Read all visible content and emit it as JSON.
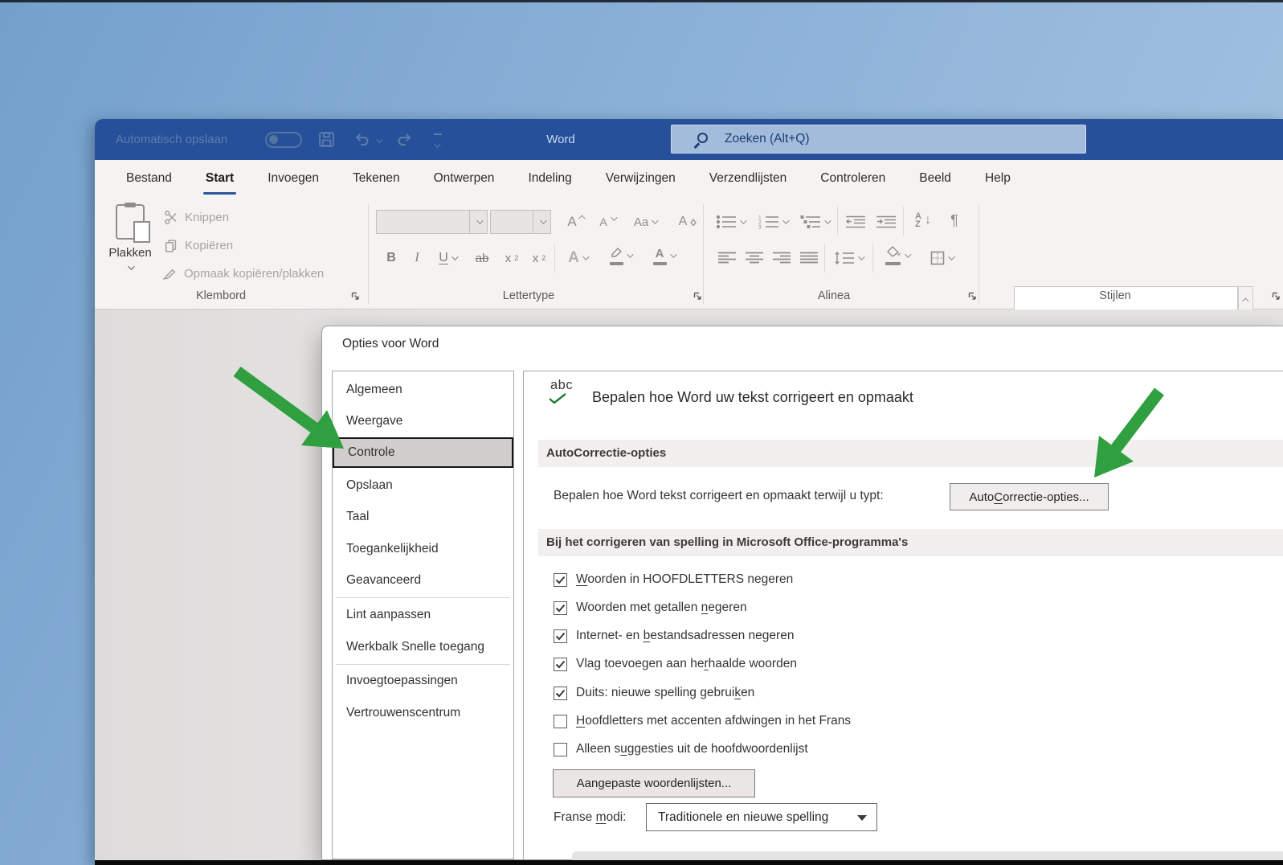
{
  "window": {
    "titlebar": {
      "autosave_label": "Automatisch opslaan",
      "autosave_on": false,
      "app_title": "Word",
      "search_placeholder": "Zoeken (Alt+Q)"
    },
    "tabs": [
      {
        "label": "Bestand",
        "active": false
      },
      {
        "label": "Start",
        "active": true
      },
      {
        "label": "Invoegen",
        "active": false
      },
      {
        "label": "Tekenen",
        "active": false
      },
      {
        "label": "Ontwerpen",
        "active": false
      },
      {
        "label": "Indeling",
        "active": false
      },
      {
        "label": "Verwijzingen",
        "active": false
      },
      {
        "label": "Verzendlijsten",
        "active": false
      },
      {
        "label": "Controleren",
        "active": false
      },
      {
        "label": "Beeld",
        "active": false
      },
      {
        "label": "Help",
        "active": false
      }
    ],
    "ribbon": {
      "clipboard": {
        "paste": "Plakken",
        "cut": "Knippen",
        "copy": "Kopiëren",
        "format_painter": "Opmaak kopiëren/plakken",
        "group_label": "Klembord"
      },
      "font": {
        "group_label": "Lettertype",
        "bold": "B",
        "italic": "I",
        "underline": "U",
        "strikethrough": "ab",
        "sub_x": "x",
        "sub_2": "2",
        "sup_x": "x",
        "sup_2": "2",
        "grow": "A",
        "shrink": "A",
        "change_case": "Aa",
        "clear_format": "A",
        "effects": "A",
        "font_color": "A"
      },
      "paragraph": {
        "group_label": "Alinea",
        "sort_a": "A",
        "sort_z": "Z",
        "sort_arrow": "↓",
        "pilcrow": "¶"
      },
      "styles": {
        "group_label": "Stijlen"
      }
    }
  },
  "dialog": {
    "title": "Opties voor Word",
    "sidebar": {
      "items": [
        {
          "label": "Algemeen",
          "selected": false
        },
        {
          "label": "Weergave",
          "selected": false
        },
        {
          "label": "Controle",
          "selected": true
        },
        {
          "label": "Opslaan",
          "selected": false
        },
        {
          "label": "Taal",
          "selected": false
        },
        {
          "label": "Toegankelijkheid",
          "selected": false
        },
        {
          "label": "Geavanceerd",
          "selected": false
        },
        {
          "label": "Lint aanpassen",
          "selected": false
        },
        {
          "label": "Werkbalk Snelle toegang",
          "selected": false
        },
        {
          "label": "Invoegtoepassingen",
          "selected": false
        },
        {
          "label": "Vertrouwenscentrum",
          "selected": false
        }
      ]
    },
    "content": {
      "abc_icon_text": "abc",
      "heading": "Bepalen hoe Word uw tekst corrigeert en opmaakt",
      "section_autocorrect": "AutoCorrectie-opties",
      "autocorrect_row_label": "Bepalen hoe Word tekst corrigeert en opmaakt terwijl u typt:",
      "autocorrect_button": {
        "pre": "Auto",
        "accel": "C",
        "post": "orrectie-opties..."
      },
      "section_spelling": "Bij het corrigeren van spelling in Microsoft Office-programma's",
      "checkboxes": [
        {
          "pre": "",
          "accel": "W",
          "post": "oorden in HOOFDLETTERS negeren",
          "checked": true
        },
        {
          "pre": "Woorden met getallen ",
          "accel": "n",
          "post": "egeren",
          "checked": true
        },
        {
          "pre": "Internet- en ",
          "accel": "b",
          "post": "estandsadressen negeren",
          "checked": true
        },
        {
          "pre": "Vlag toevoegen aan he",
          "accel": "r",
          "post": "haalde woorden",
          "checked": true
        },
        {
          "pre": "Duits: nieuwe spelling gebrui",
          "accel": "k",
          "post": "en",
          "checked": true
        },
        {
          "pre": "",
          "accel": "H",
          "post": "oofdletters met accenten afdwingen in het Frans",
          "checked": false
        },
        {
          "pre": "Alleen s",
          "accel": "u",
          "post": "ggesties uit de hoofdwoordenlijst",
          "checked": false
        }
      ],
      "custom_dictionaries_button": "Aangepaste woordenlijsten...",
      "french_modes_label": {
        "pre": "Franse ",
        "accel": "m",
        "post": "odi:"
      },
      "french_modes_value": "Traditionele en nieuwe spelling"
    }
  },
  "annotations": {
    "arrow_color": "#2f9f3f",
    "arrows": [
      {
        "points_at": "Controle sidebar item"
      },
      {
        "points_at": "AutoCorrectie-opties button"
      }
    ]
  },
  "colors": {
    "titlebar": "#27509b",
    "search_bg": "#a3bcdc",
    "ribbon_bg": "#f5f3f2",
    "tab_underline": "#2b579a",
    "selected_sidebar_bg": "#d1cecb",
    "section_band": "#f1f0ef",
    "annotation_green": "#2f9f3f",
    "bottom_bar": "#0a0a0a"
  },
  "icons": {
    "autosave": "toggle-pill",
    "save": "floppy-outline",
    "undo": "curved-arrow-left",
    "redo": "curved-arrow-right",
    "quick_access": "bar-with-chevron",
    "search": "magnifier",
    "paste": "clipboard-with-page",
    "cut": "scissors",
    "copy": "two-pages",
    "format_painter": "brush",
    "dialog_launcher": "corner-se-arrow",
    "abc_spellcheck": "abc-with-green-check",
    "annotation": "green-arrow"
  }
}
